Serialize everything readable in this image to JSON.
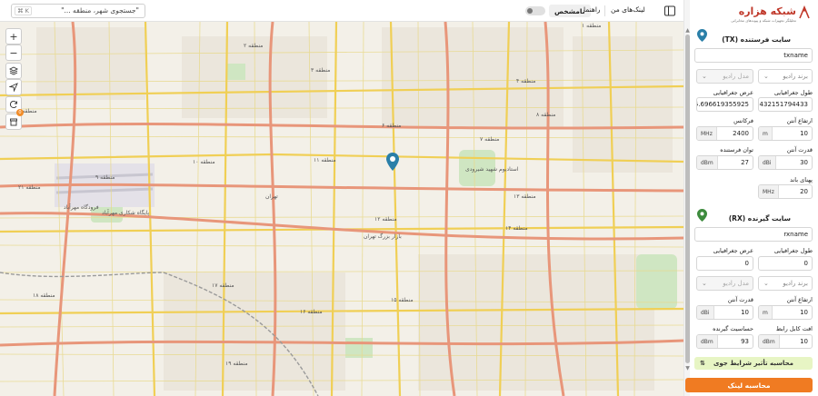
{
  "topbar": {
    "search_placeholder": "\"جستجوی شهر، منطقه ...\"",
    "kbd": "⌘ K",
    "my_links": "لینک‌های من",
    "guide": "راهنما",
    "unknown": "نامشخص"
  },
  "map": {
    "labels": [
      "منطقه ۱",
      "منطقه ۲",
      "منطقه ۳",
      "منطقه ۴",
      "منطقه ۵",
      "منطقه ۶",
      "منطقه ۷",
      "منطقه ۸",
      "منطقه ۹",
      "منطقه ۱۰",
      "منطقه ۱۱",
      "منطقه ۱۲",
      "منطقه ۱۳",
      "منطقه ۱۴",
      "منطقه ۱۵",
      "منطقه ۱۶",
      "منطقه ۱۷",
      "منطقه ۱۸",
      "منطقه ۱۹",
      "منطقه ۲۱",
      "منطقه ۲۲",
      "تهران",
      "بازار بزرگ تهران",
      "پایگاه شکاری مهرآباد",
      "فرودگاه مهرآباد",
      "استادیوم شهید شیرودی"
    ],
    "badge": "0"
  },
  "panel": {
    "brand": "شبکه هزاره",
    "tagline": "تحلیلگر تجهیزات شبکه و پیوندهای مخابراتی",
    "tx": {
      "title": "سایت فرستنده (TX)",
      "name": "txname",
      "brand_placeholder": "برند رادیو",
      "model_placeholder": "مدل رادیو",
      "lon_label": "طول جغرافیایی",
      "lon": "51.432151794433",
      "lat_label": "عرض جغرافیایی",
      "lat": "35.696619355925",
      "height_label": "ارتفاع آنتن",
      "height": "10",
      "height_unit": "m",
      "freq_label": "فرکانس",
      "freq": "2400",
      "freq_unit": "MHz",
      "gain_label": "قدرت آنتن",
      "gain": "30",
      "gain_unit": "dBi",
      "power_label": "توان فرستنده",
      "power": "27",
      "power_unit": "dBm",
      "bw_label": "پهنای باند",
      "bw": "20",
      "bw_unit": "MHz"
    },
    "rx": {
      "title": "سایت گیرنده (RX)",
      "name": "rxname",
      "lon_label": "طول جغرافیایی",
      "lon": "0",
      "lat_label": "عرض جغرافیایی",
      "lat": "0",
      "brand_placeholder": "برند رادیو",
      "model_placeholder": "مدل رادیو",
      "height_label": "ارتفاع آنتن",
      "height": "10",
      "height_unit": "m",
      "gain_label": "قدرت آنتن",
      "gain": "10",
      "gain_unit": "dBi",
      "loss_label": "افت کابل رابط",
      "loss": "10",
      "loss_unit": "dBm",
      "sens_label": "حساسیت گیرنده",
      "sens": "93",
      "sens_unit": "dBm"
    },
    "weather_button": "محاسبه تأثیر شرایط جوی",
    "calc_button": "محاسبه لینک"
  },
  "colors": {
    "accent": "#f07b22",
    "tx_pin": "#2a7fa8",
    "rx_pin": "#3d8b3d",
    "weather_bg": "#e7f5c4"
  }
}
